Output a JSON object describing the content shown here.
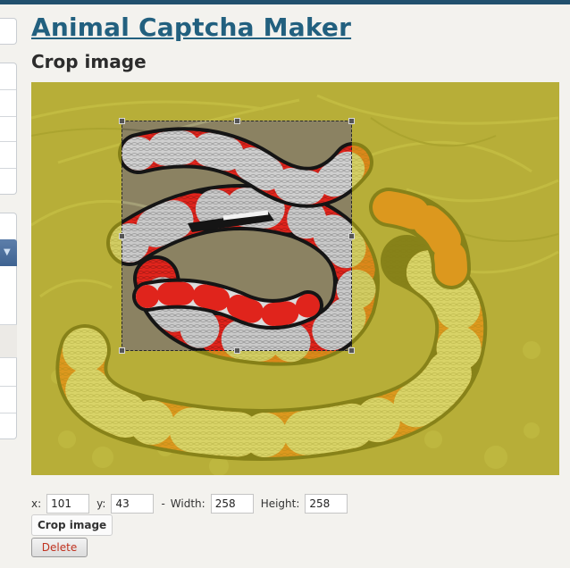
{
  "page": {
    "title": "Animal Captcha Maker",
    "subtitle": "Crop image"
  },
  "crop": {
    "x_label": "x:",
    "x_value": "101",
    "y_label": "y:",
    "y_value": "43",
    "separator": "-",
    "width_label": "Width:",
    "width_value": "258",
    "height_label": "Height:",
    "height_value": "258",
    "crop_button": "Crop image",
    "delete_button": "Delete"
  },
  "colors": {
    "accent": "#22607f",
    "top_bar": "#21506e",
    "delete_text": "#c0321f"
  }
}
